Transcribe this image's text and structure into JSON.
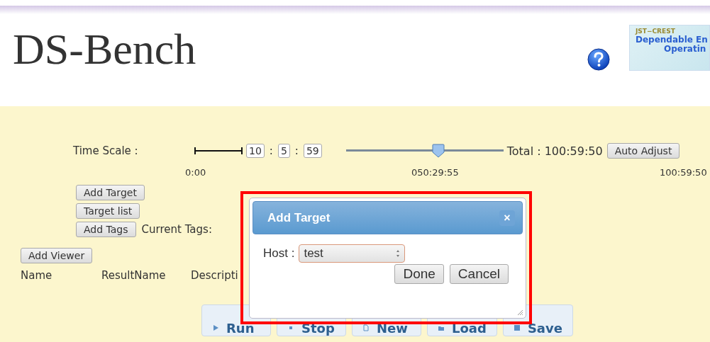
{
  "header": {
    "title": "DS-Bench",
    "banner": {
      "line_1": "JST−CREST",
      "line_2": "Dependable En",
      "line_3": "Operatin"
    }
  },
  "time_scale": {
    "label": "Time Scale :",
    "hours": "10",
    "separator_1": ":",
    "minutes": "5",
    "separator_2": ":",
    "seconds": "59",
    "slider": {
      "level": 0.585
    },
    "total": "Total : 100:59:50",
    "auto_adjust": "Auto Adjust",
    "ticks": [
      "0:00",
      "050:29:55",
      "100:59:50"
    ]
  },
  "target_buttons": [
    "Add Target",
    "Target list",
    "Add Tags"
  ],
  "current_tags_label": "Current Tags:",
  "add_viewer": "Add Viewer",
  "columns": [
    "Name",
    "ResultName",
    "Descripti"
  ],
  "actions": [
    {
      "label": "Run",
      "kind": "play"
    },
    {
      "label": "Stop",
      "kind": "stop"
    },
    {
      "label": "New",
      "kind": "new"
    },
    {
      "label": "Load",
      "kind": "folder"
    },
    {
      "label": "Save",
      "kind": "disk"
    }
  ],
  "dialog": {
    "title": "Add Target",
    "close": "×",
    "host_label": "Host :",
    "host_value": "test",
    "buttons": [
      "Done",
      "Cancel"
    ]
  }
}
